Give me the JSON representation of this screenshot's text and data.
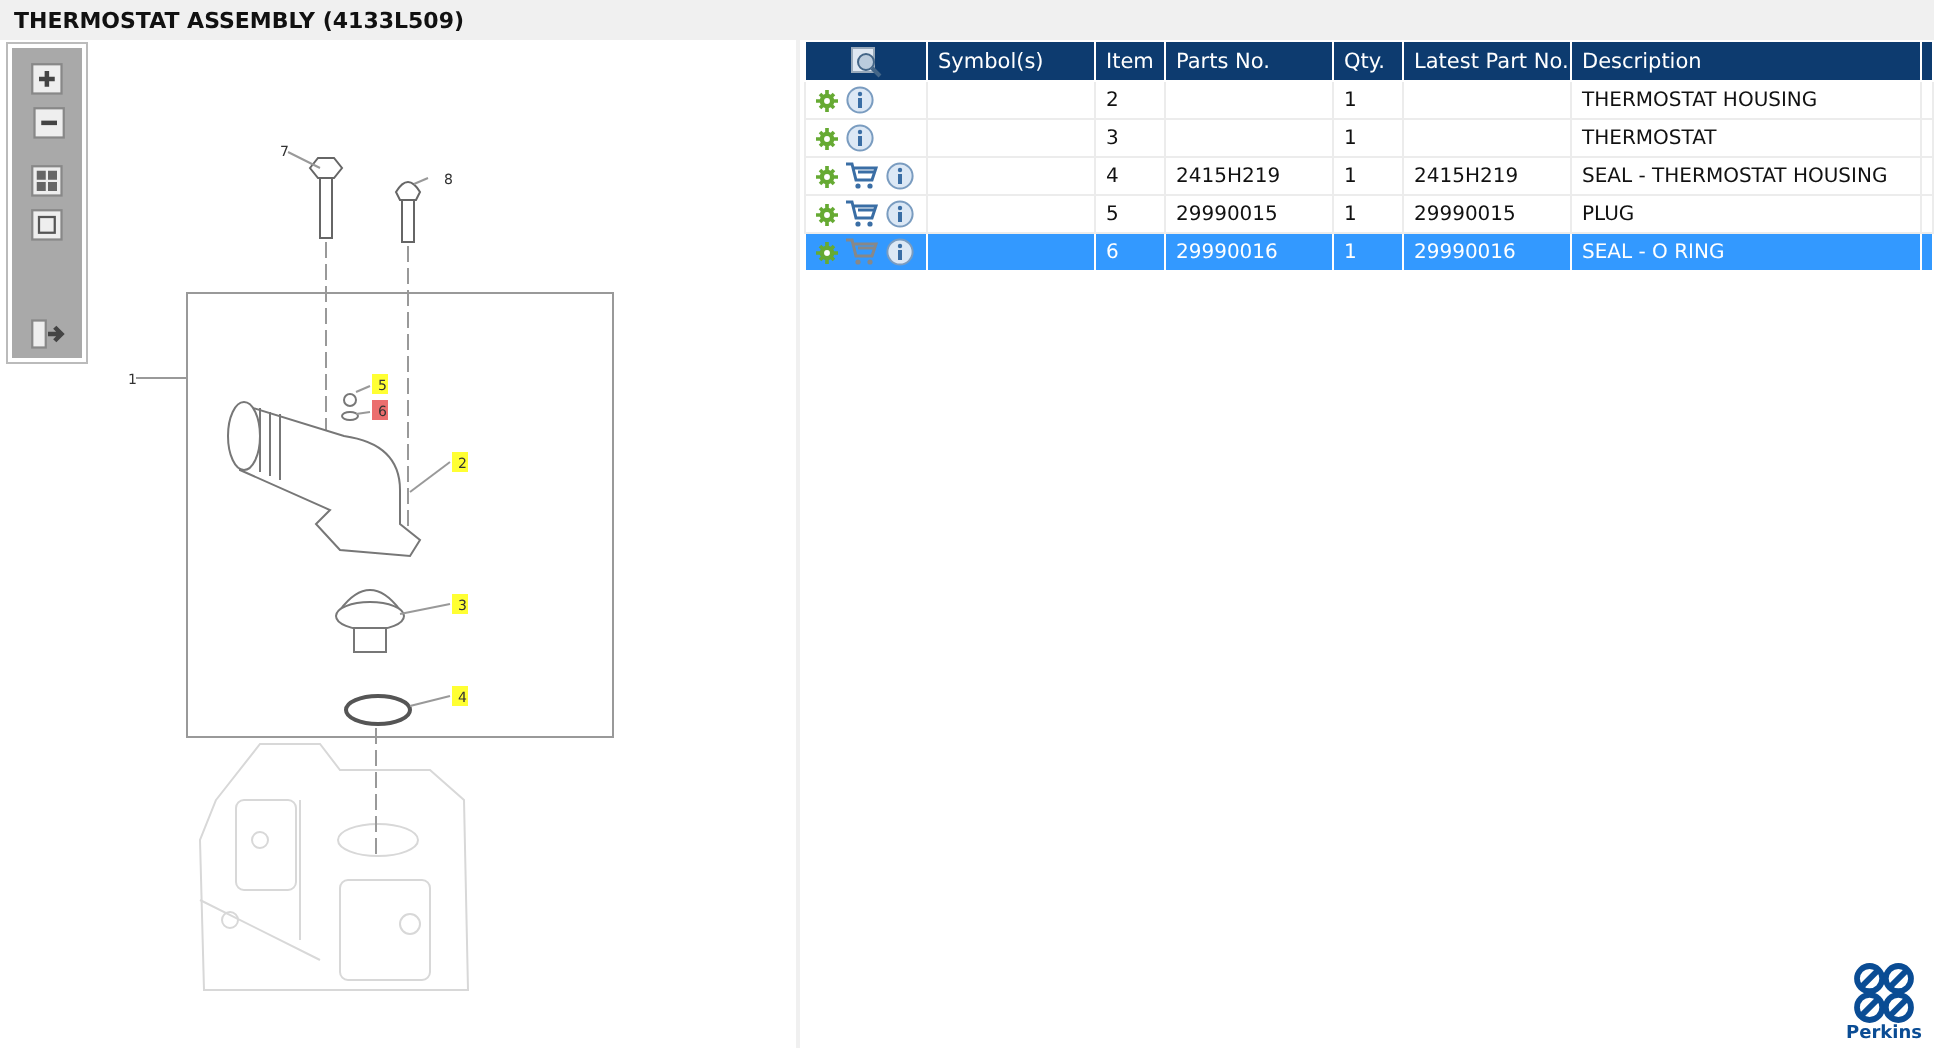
{
  "title": "THERMOSTAT ASSEMBLY (4133L509)",
  "callouts": [
    {
      "label": "7",
      "highlighted": false,
      "selected": false
    },
    {
      "label": "8",
      "highlighted": false,
      "selected": false
    },
    {
      "label": "1",
      "highlighted": false,
      "selected": false
    },
    {
      "label": "5",
      "highlighted": true,
      "selected": false
    },
    {
      "label": "6",
      "highlighted": false,
      "selected": true
    },
    {
      "label": "2",
      "highlighted": true,
      "selected": false
    },
    {
      "label": "3",
      "highlighted": true,
      "selected": false
    },
    {
      "label": "4",
      "highlighted": true,
      "selected": false
    }
  ],
  "table": {
    "columns": [
      "Symbol(s)",
      "Item",
      "Parts No.",
      "Qty.",
      "Latest Part No.",
      "Description"
    ],
    "rows": [
      {
        "cart": false,
        "selected": false,
        "cells": [
          "",
          "2",
          "",
          "1",
          "",
          "THERMOSTAT HOUSING"
        ]
      },
      {
        "cart": false,
        "selected": false,
        "cells": [
          "",
          "3",
          "",
          "1",
          "",
          "THERMOSTAT"
        ]
      },
      {
        "cart": true,
        "selected": false,
        "cells": [
          "",
          "4",
          "2415H219",
          "1",
          "2415H219",
          "SEAL - THERMOSTAT HOUSING"
        ]
      },
      {
        "cart": true,
        "selected": false,
        "cells": [
          "",
          "5",
          "29990015",
          "1",
          "29990015",
          "PLUG"
        ]
      },
      {
        "cart": true,
        "selected": true,
        "cells": [
          "",
          "6",
          "29990016",
          "1",
          "29990016",
          "SEAL - O RING"
        ]
      }
    ]
  },
  "logo": {
    "text": "Perkins"
  }
}
